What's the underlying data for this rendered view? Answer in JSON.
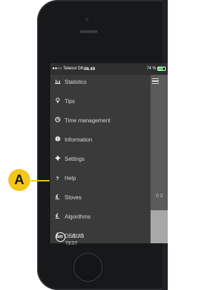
{
  "status_bar": {
    "carrier": "●●○○ Telenor DK",
    "time": "08.49",
    "battery": "74 %",
    "battery_level": 0.74
  },
  "menu": {
    "items": [
      {
        "label": "Statistics",
        "icon": "bar-chart-icon"
      },
      {
        "label": "Tips",
        "icon": "lightbulb-icon"
      },
      {
        "label": "Time management",
        "icon": "clock-icon"
      },
      {
        "label": "Information",
        "icon": "info-icon"
      },
      {
        "label": "Settings",
        "icon": "gear-icon"
      },
      {
        "label": "Help",
        "icon": "question-icon"
      },
      {
        "label": "Stoves",
        "icon": "stove-icon"
      },
      {
        "label": "Algorithms",
        "icon": "stove-icon"
      },
      {
        "label": "DEBUG",
        "icon": "stove-icon"
      }
    ]
  },
  "footer": {
    "logo_text": "HS",
    "version": "v1.7.5",
    "build": "TEST"
  },
  "right_panel": {
    "partial_text": "0 2"
  },
  "callout": {
    "label": "A"
  },
  "colors": {
    "callout": "#f5c61a",
    "drawer_bg": "#3a3a3a",
    "status_bar_bg": "#2f2f30"
  }
}
